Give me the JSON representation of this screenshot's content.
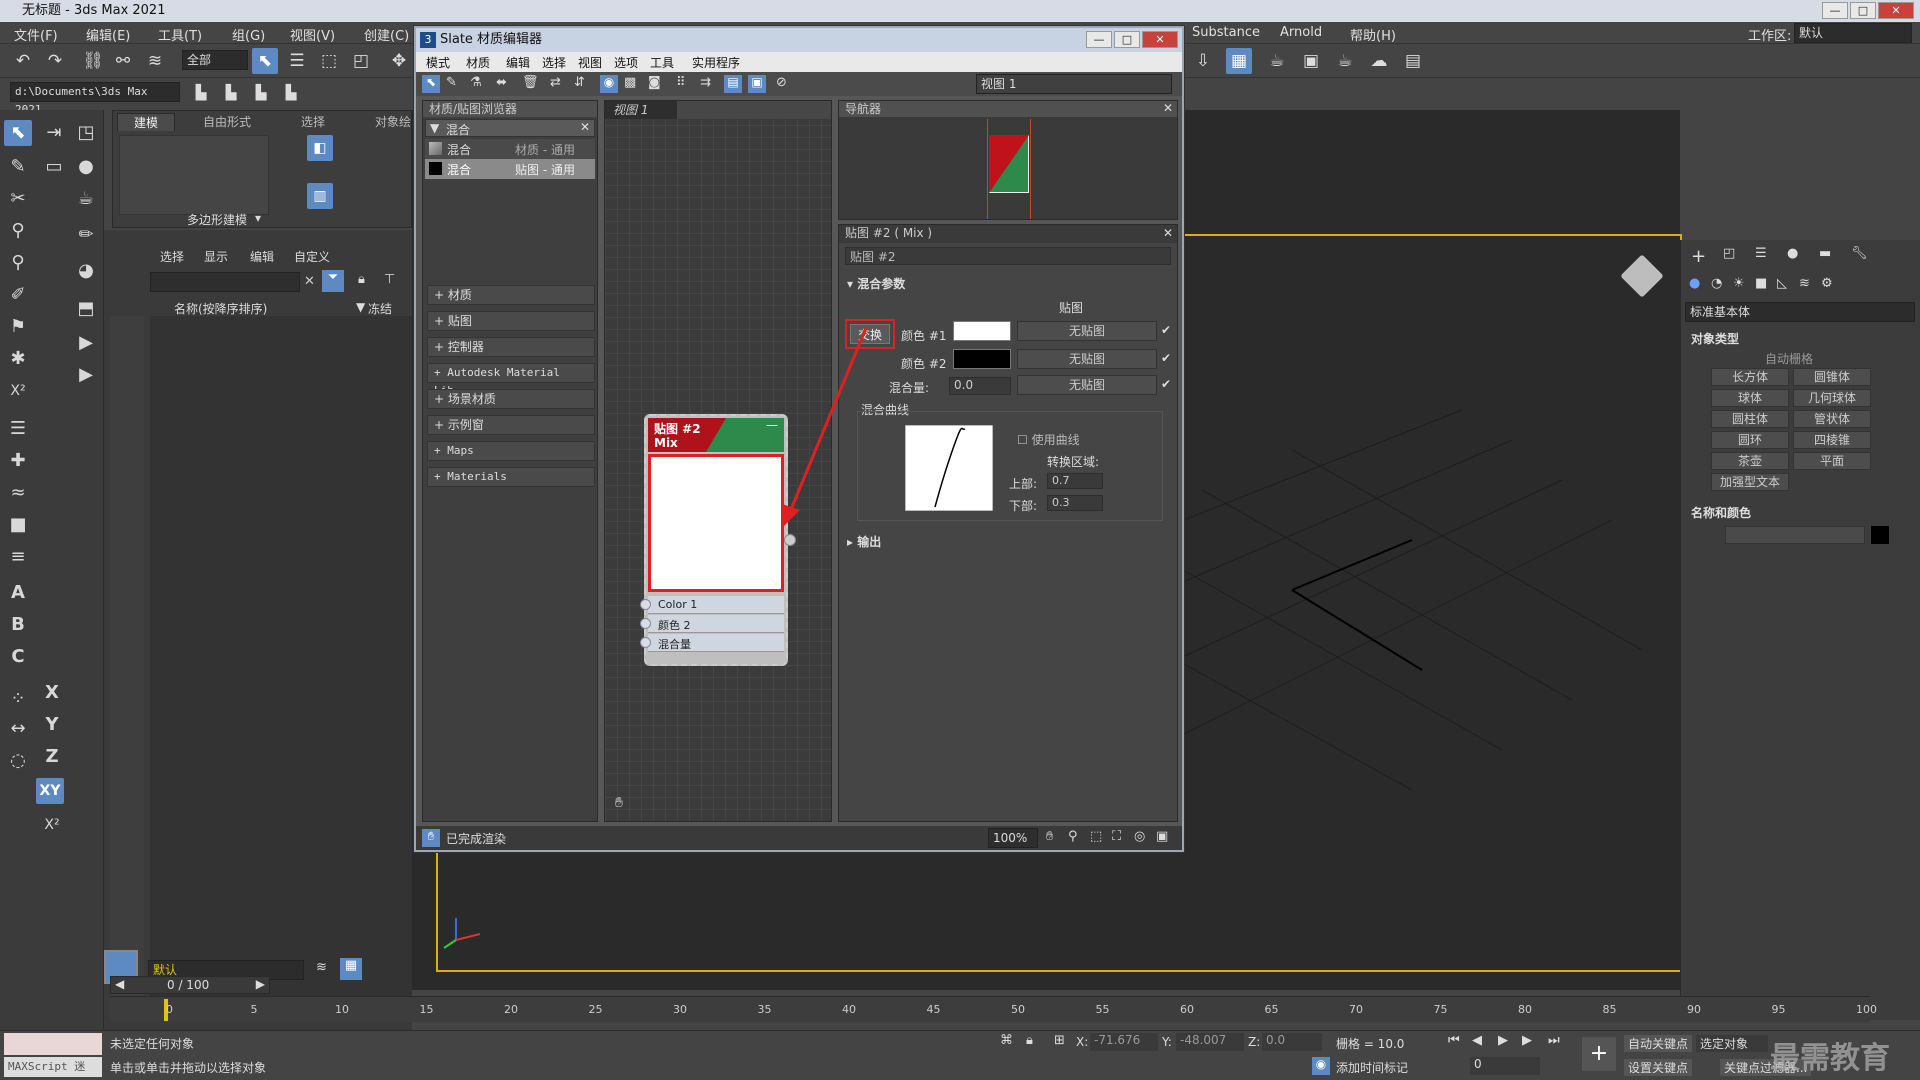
{
  "window": {
    "title": "无标题 - 3ds Max 2021"
  },
  "menubar": {
    "items": [
      "文件(F)",
      "编辑(E)",
      "工具(T)",
      "组(G)",
      "视图(V)",
      "创建(C)"
    ],
    "right_items": [
      "Substance",
      "Arnold",
      "帮助(H)"
    ],
    "workspace_label": "工作区:",
    "workspace_value": "默认"
  },
  "toolbar": {
    "selection_filter": "全部",
    "project_path": "d:\\Documents\\3ds Max 2021"
  },
  "ribbon": {
    "tabs": [
      "建模",
      "自由形式",
      "选择",
      "对象绘"
    ],
    "group_label": "多边形建模"
  },
  "scene_explorer": {
    "menu": [
      "选择",
      "显示",
      "编辑",
      "自定义"
    ],
    "col_name": "名称(按降序排序)",
    "col_freeze": "冻结",
    "layer": "默认"
  },
  "slate": {
    "title": "Slate 材质编辑器",
    "menu": [
      "模式",
      "材质",
      "编辑",
      "选择",
      "视图",
      "选项",
      "工具",
      "实用程序"
    ],
    "view_dropdown": "视图 1",
    "browser": {
      "title": "材质/贴图浏览器",
      "search_group": "混合",
      "results": [
        {
          "name": "混合",
          "type": "材质 - 通用"
        },
        {
          "name": "混合",
          "type": "贴图 - 通用"
        }
      ],
      "groups": [
        "+ 材质",
        "+ 贴图",
        "+ 控制器",
        "+ Autodesk Material Lib···",
        "+ 场景材质",
        "+ 示例窗",
        "+ Maps",
        "+ Materials"
      ]
    },
    "view_tab": "视图 1",
    "navigator_title": "导航器",
    "node": {
      "title": "贴图 #2",
      "subtitle": "Mix",
      "slots": [
        "Color 1",
        "颜色 2",
        "混合量"
      ]
    },
    "params": {
      "title": "贴图 #2 ( Mix )",
      "name_field": "贴图 #2",
      "rollout": "混合参数",
      "map_header": "贴图",
      "swap": "交换",
      "color1_label": "颜色 #1",
      "color2_label": "颜色 #2",
      "no_map": "无贴图",
      "mix_amount_label": "混合量:",
      "mix_amount_value": "0.0",
      "curve_group": "混合曲线",
      "use_curve": "使用曲线",
      "transition_zone": "转换区域:",
      "upper_label": "上部:",
      "upper_value": "0.7",
      "lower_label": "下部:",
      "lower_value": "0.3",
      "output_rollout": "输出"
    },
    "status": "已完成渲染",
    "zoom": "100%"
  },
  "command_panel": {
    "category": "标准基本体",
    "object_type_title": "对象类型",
    "autogrid": "自动栅格",
    "buttons": [
      "长方体",
      "圆锥体",
      "球体",
      "几何球体",
      "圆柱体",
      "管状体",
      "圆环",
      "四棱锥",
      "茶壶",
      "平面",
      "加强型文本"
    ],
    "name_color_title": "名称和颜色"
  },
  "timeline": {
    "frame": "0 / 100",
    "ticks": [
      "0",
      "5",
      "10",
      "15",
      "20",
      "25",
      "30",
      "35",
      "40",
      "45",
      "50",
      "55",
      "60",
      "65",
      "70",
      "75",
      "80",
      "85",
      "90",
      "95",
      "100"
    ]
  },
  "status": {
    "line1": "未选定任何对象",
    "line2": "单击或单击并拖动以选择对象",
    "maxscript": "MAXScript 迷",
    "x_label": "X:",
    "x_value": "-71.676",
    "y_label": "Y:",
    "y_value": "-48.007",
    "z_label": "Z:",
    "z_value": "0.0",
    "grid": "栅格 = 10.0",
    "add_time_tag": "添加时间标记",
    "auto_key": "自动关键点",
    "selected": "选定对象",
    "set_key": "设置关键点",
    "key_filter": "关键点过滤器...",
    "frame_value": "0"
  },
  "watermark": "最需教育",
  "colors": {
    "highlight": "#e02020",
    "accent": "#5e8ac4",
    "viewport_border": "#e0b000",
    "node_red": "#b0121a",
    "node_green": "#2e8a4a"
  }
}
